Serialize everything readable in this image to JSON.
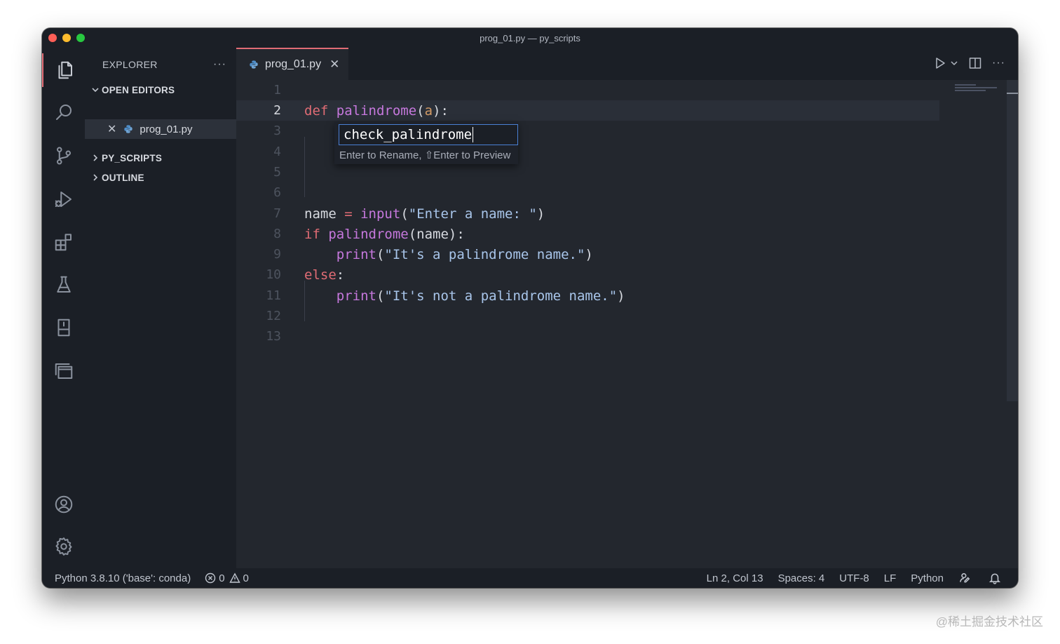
{
  "window": {
    "title": "prog_01.py — py_scripts"
  },
  "sidebar": {
    "header": "EXPLORER",
    "more": "···",
    "sections": [
      {
        "label": "OPEN EDITORS"
      },
      {
        "label": "PY_SCRIPTS"
      },
      {
        "label": "OUTLINE"
      }
    ],
    "open_file": "prog_01.py"
  },
  "activity_bar": {
    "icons": [
      "explorer-icon",
      "search-icon",
      "source-control-icon",
      "run-debug-icon",
      "extensions-icon",
      "testing-icon",
      "remote-explorer-icon",
      "panel-icon",
      "account-icon",
      "settings-gear-icon"
    ]
  },
  "tab": {
    "label": "prog_01.py"
  },
  "editor": {
    "line_numbers": [
      "1",
      "2",
      "3",
      "4",
      "5",
      "6",
      "7",
      "8",
      "9",
      "10",
      "11",
      "12",
      "13"
    ],
    "current_line": "2",
    "line2": {
      "kw": "def",
      "fn": "palindrome",
      "p1": "(",
      "param": "a",
      "p2": "):"
    },
    "line7": {
      "var": "name ",
      "op": "=",
      "sp": " ",
      "bi": "input",
      "p1": "(",
      "str": "\"Enter a name: \"",
      "p2": ")"
    },
    "line8": {
      "kw": "if",
      "sp": " ",
      "fn": "palindrome",
      "rest": "(name):"
    },
    "line9": {
      "indent": "    ",
      "bi": "print",
      "p1": "(",
      "str": "\"It's a palindrome name.\"",
      "p2": ")"
    },
    "line10": {
      "kw": "else",
      "rest": ":"
    },
    "line11": {
      "indent": "    ",
      "bi": "print",
      "p1": "(",
      "str": "\"It's not a palindrome name.\"",
      "p2": ")"
    },
    "rename": {
      "value": "check_palindrome",
      "hint": "Enter to Rename, ⇧Enter to Preview"
    }
  },
  "statusbar": {
    "interpreter": "Python 3.8.10 ('base': conda)",
    "errors": "0",
    "warnings": "0",
    "position": "Ln 2, Col 13",
    "spaces": "Spaces: 4",
    "encoding": "UTF-8",
    "eol": "LF",
    "language": "Python"
  },
  "watermark": "@稀土掘金技术社区",
  "colors": {
    "accent": "#e06c75",
    "keyword": "#e06c75",
    "function": "#c678dd",
    "string": "#a8c5ea",
    "rename_border": "#4a7fd4"
  }
}
